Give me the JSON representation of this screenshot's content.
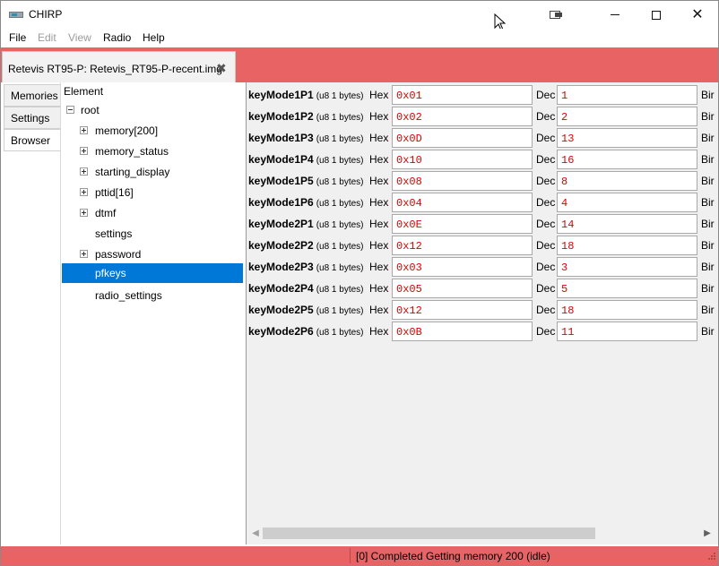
{
  "window": {
    "title": "CHIRP",
    "minimize_glyph": "",
    "maximize_glyph": "",
    "close_glyph": "✕"
  },
  "menu": [
    {
      "label": "File",
      "enabled": true
    },
    {
      "label": "Edit",
      "enabled": false
    },
    {
      "label": "View",
      "enabled": false
    },
    {
      "label": "Radio",
      "enabled": true
    },
    {
      "label": "Help",
      "enabled": true
    }
  ],
  "file_tab": {
    "label": "Retevis RT95-P: Retevis_RT95-P-recent.img",
    "close_glyph": "✖"
  },
  "side_tabs": [
    "Memories",
    "Settings",
    "Browser"
  ],
  "tree": {
    "header": "Element",
    "root": "root",
    "items": [
      {
        "label": "memory[200]",
        "expandable": true
      },
      {
        "label": "memory_status",
        "expandable": true
      },
      {
        "label": "starting_display",
        "expandable": true
      },
      {
        "label": "pttid[16]",
        "expandable": true
      },
      {
        "label": "dtmf",
        "expandable": true
      },
      {
        "label": "settings",
        "expandable": false
      },
      {
        "label": "password",
        "expandable": true
      },
      {
        "label": "pfkeys",
        "expandable": false,
        "selected": true
      },
      {
        "label": "radio_settings",
        "expandable": false
      }
    ]
  },
  "fields": {
    "hex_label": "Hex",
    "dec_label": "Dec",
    "bin_label": "Bir",
    "type_label": "(u8 1 bytes)",
    "rows": [
      {
        "name": "keyMode1P1",
        "hex": "0x01",
        "dec": "1"
      },
      {
        "name": "keyMode1P2",
        "hex": "0x02",
        "dec": "2"
      },
      {
        "name": "keyMode1P3",
        "hex": "0x0D",
        "dec": "13"
      },
      {
        "name": "keyMode1P4",
        "hex": "0x10",
        "dec": "16"
      },
      {
        "name": "keyMode1P5",
        "hex": "0x08",
        "dec": "8"
      },
      {
        "name": "keyMode1P6",
        "hex": "0x04",
        "dec": "4"
      },
      {
        "name": "keyMode2P1",
        "hex": "0x0E",
        "dec": "14"
      },
      {
        "name": "keyMode2P2",
        "hex": "0x12",
        "dec": "18"
      },
      {
        "name": "keyMode2P3",
        "hex": "0x03",
        "dec": "3"
      },
      {
        "name": "keyMode2P4",
        "hex": "0x05",
        "dec": "5"
      },
      {
        "name": "keyMode2P5",
        "hex": "0x12",
        "dec": "18"
      },
      {
        "name": "keyMode2P6",
        "hex": "0x0B",
        "dec": "11"
      }
    ]
  },
  "scrollbar": {
    "left_arrow": "◀",
    "right_arrow": "▶"
  },
  "status": {
    "text": "[0] Completed Getting memory 200 (idle)"
  },
  "colors": {
    "accent": "#e86464",
    "selection": "#0078d7",
    "value_text": "#e00000"
  }
}
